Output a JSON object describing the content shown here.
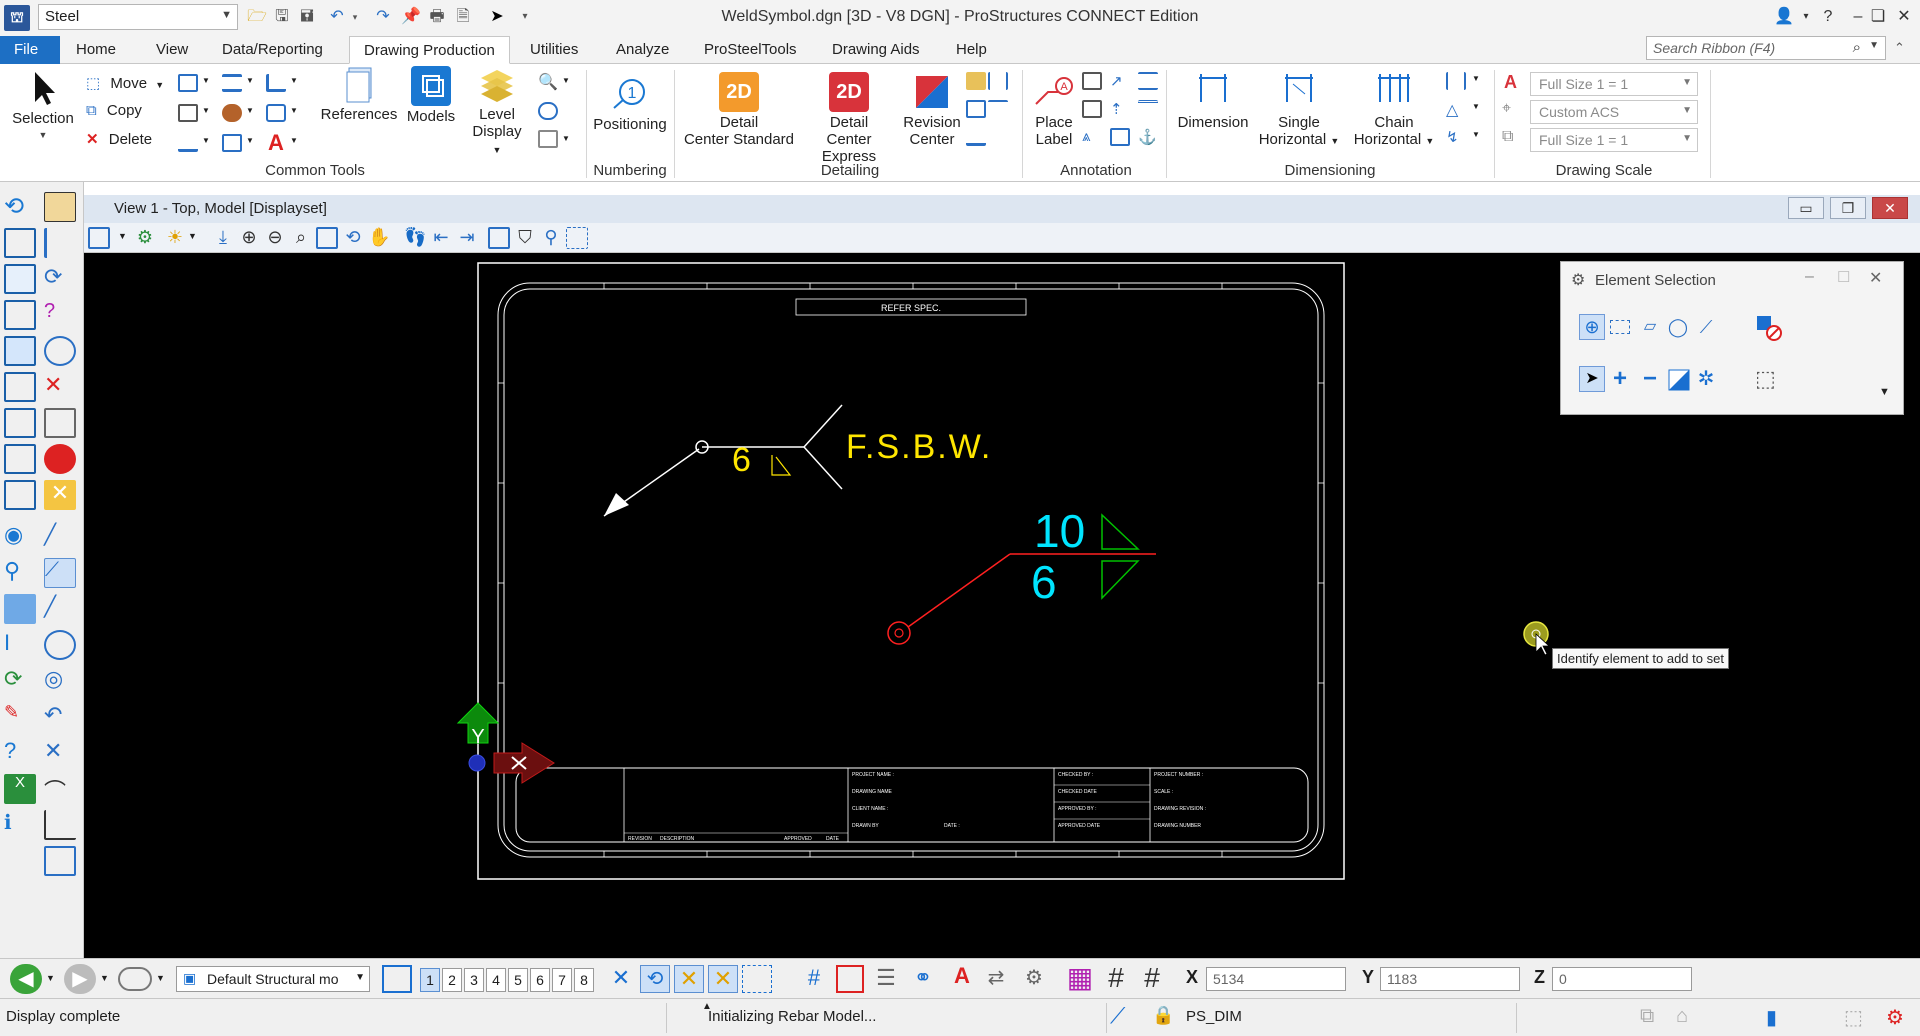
{
  "window": {
    "title": "WeldSymbol.dgn [3D - V8 DGN] - ProStructures CONNECT Edition",
    "workset": "Steel",
    "controls": [
      "?",
      "–",
      "❏",
      "✕"
    ]
  },
  "ribbon_tabs": [
    "File",
    "Home",
    "View",
    "Data/Reporting",
    "Drawing Production",
    "Utilities",
    "Analyze",
    "ProSteelTools",
    "Drawing Aids",
    "Help"
  ],
  "active_tab": "Drawing Production",
  "ribbon_search": {
    "placeholder": "Search Ribbon (F4)"
  },
  "ribbon": {
    "selection": "Selection",
    "move": "Move",
    "copy": "Copy",
    "delete": "Delete",
    "references": "References",
    "models": "Models",
    "level_display_1": "Level",
    "level_display_2": "Display",
    "positioning": "Positioning",
    "detail_center_standard_1": "Detail",
    "detail_center_standard_2": "Center Standard",
    "detail_center_express_1": "Detail",
    "detail_center_express_2": "Center Express",
    "revision_center_1": "Revision",
    "revision_center_2": "Center",
    "place_label_1": "Place",
    "place_label_2": "Label",
    "dimension": "Dimension",
    "single_horizontal_1": "Single",
    "single_horizontal_2": "Horizontal",
    "chain_horizontal_1": "Chain",
    "chain_horizontal_2": "Horizontal",
    "scale_1": "Full Size 1 = 1",
    "acs": "Custom ACS",
    "scale_2": "Full Size 1 = 1",
    "groups": {
      "common_tools": "Common Tools",
      "numbering": "Numbering",
      "detailing": "Detailing",
      "annotation": "Annotation",
      "dimensioning": "Dimensioning",
      "drawing_scale": "Drawing Scale"
    },
    "badge_2d": "2D"
  },
  "view": {
    "title": "View 1 - Top, Model [Displayset]"
  },
  "drawing": {
    "refer_spec": "REFER SPEC.",
    "weld1_size": "6",
    "weld1_tail": "F.S.B.W.",
    "weld2_top": "10",
    "weld2_bottom": "6",
    "axis_y": "Y",
    "title_block": {
      "project_name": "PROJECT NAME :",
      "drawing_name": "DRAWING NAME",
      "client_name": "CLIENT NAME :",
      "drawn_by": "DRAWN BY",
      "date": "DATE :",
      "checked_by": "CHECKED BY :",
      "checked_date": "CHECKED DATE",
      "approved_by": "APPROVED BY :",
      "approved_date": "APPROVED DATE",
      "project_number": "PROJECT NUMBER :",
      "scale": "SCALE :",
      "drawing_revision": "DRAWING REVISION :",
      "drawing_number": "DRAWING NUMBER",
      "revision": "REVISION",
      "description": "DESCRIPTION",
      "approved": "APPROVED",
      "date_col": "DATE"
    }
  },
  "element_selection": {
    "title": "Element Selection"
  },
  "tooltip": "Identify element to add to set",
  "bottom": {
    "model": "Default Structural mo",
    "view_numbers": [
      "1",
      "2",
      "3",
      "4",
      "5",
      "6",
      "7",
      "8"
    ],
    "x_label": "X",
    "x_value": "5134",
    "y_label": "Y",
    "y_value": "1183",
    "z_label": "Z",
    "z_value": "0"
  },
  "status": {
    "left": "Display complete",
    "middle": "Initializing Rebar Model...",
    "level": "PS_DIM"
  },
  "colors": {
    "accent": "#1d6fc4",
    "weld_yellow": "#ffe600",
    "weld_cyan": "#00e5ff",
    "weld_red": "#ff2020",
    "weld_green": "#00c000"
  }
}
